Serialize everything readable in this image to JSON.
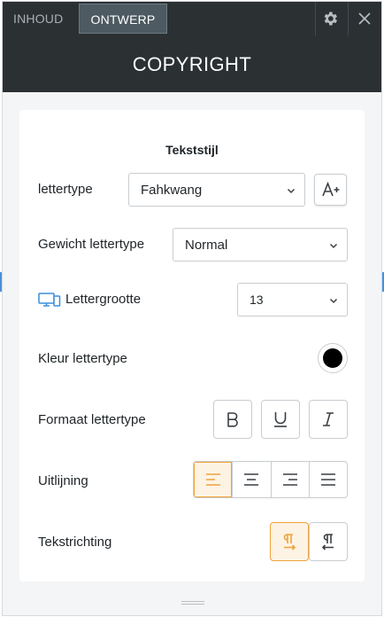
{
  "tabs": {
    "content_label": "INHOUD",
    "design_label": "ONTWERP"
  },
  "header": {
    "title": "COPYRIGHT"
  },
  "text_style": {
    "section_title": "Tekststijl",
    "font": {
      "label": "lettertype",
      "value": "Fahkwang"
    },
    "weight": {
      "label": "Gewicht lettertype",
      "value": "Normal"
    },
    "size": {
      "label": "Lettergrootte",
      "value": "13"
    },
    "color": {
      "label": "Kleur lettertype",
      "value": "#000000"
    },
    "format": {
      "label": "Formaat lettertype"
    },
    "alignment": {
      "label": "Uitlijning",
      "selected": "left"
    },
    "direction": {
      "label": "Tekstrichting",
      "selected": "ltr"
    }
  },
  "icons": {
    "settings": "gear-icon",
    "close": "close-icon",
    "add_font": "add-font-icon",
    "devices": "devices-icon",
    "bold": "bold-icon",
    "underline": "underline-icon",
    "italic": "italic-icon",
    "align_left": "align-left-icon",
    "align_center": "align-center-icon",
    "align_right": "align-right-icon",
    "align_justify": "align-justify-icon",
    "ltr": "text-direction-ltr-icon",
    "rtl": "text-direction-rtl-icon"
  },
  "colors": {
    "accent": "#f0a23b",
    "accent_bg": "#fdf3e4",
    "header_bg": "#2b3033",
    "active_tab_bg": "#4d5a62",
    "device_icon": "#3b8ede"
  }
}
